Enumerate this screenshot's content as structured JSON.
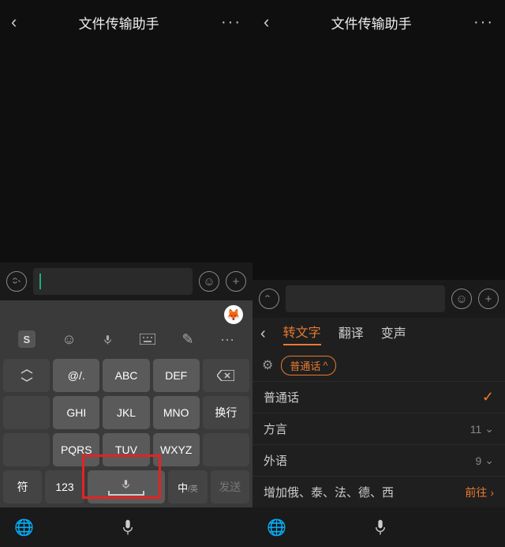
{
  "left": {
    "header": {
      "title": "文件传输助手"
    },
    "keyboard": {
      "row1": [
        {
          "label": "",
          "dark": true,
          "name": "kb-key-toggle"
        },
        {
          "label": "@/.",
          "name": "kb-key-at"
        },
        {
          "label": "ABC",
          "name": "kb-key-abc"
        },
        {
          "label": "DEF",
          "name": "kb-key-def"
        },
        {
          "label": "",
          "dark": true,
          "name": "kb-key-backspace"
        }
      ],
      "row2": [
        {
          "label": "",
          "dark": true,
          "name": "kb-key-back"
        },
        {
          "label": "GHI",
          "name": "kb-key-ghi"
        },
        {
          "label": "JKL",
          "name": "kb-key-jkl"
        },
        {
          "label": "MNO",
          "name": "kb-key-mno"
        },
        {
          "label": "换行",
          "dark": true,
          "name": "kb-key-newline"
        }
      ],
      "row3": [
        {
          "label": "",
          "dark": true,
          "name": "kb-key-blank"
        },
        {
          "label": "PQRS",
          "name": "kb-key-pqrs"
        },
        {
          "label": "TUV",
          "name": "kb-key-tuv"
        },
        {
          "label": "WXYZ",
          "name": "kb-key-wxyz"
        },
        {
          "label": "",
          "dark": true,
          "name": "kb-key-blank2"
        }
      ],
      "row4": [
        {
          "label": "符",
          "dark": true,
          "name": "kb-key-symbols"
        },
        {
          "label": "123",
          "dark": true,
          "name": "kb-key-numbers"
        },
        {
          "label": "",
          "space": true,
          "name": "kb-key-space-voice"
        },
        {
          "label": "中/英",
          "dark": true,
          "name": "kb-key-lang"
        },
        {
          "label": "发送",
          "dark": true,
          "name": "kb-key-send"
        }
      ]
    }
  },
  "right": {
    "header": {
      "title": "文件传输助手"
    },
    "tabs": [
      {
        "label": "转文字",
        "active": true
      },
      {
        "label": "翻译",
        "active": false
      },
      {
        "label": "变声",
        "active": false
      }
    ],
    "pill": "普通话",
    "langRows": [
      {
        "label": "普通话",
        "checked": true
      },
      {
        "label": "方言",
        "count": "11"
      },
      {
        "label": "外语",
        "count": "9"
      },
      {
        "label": "增加俄、泰、法、德、西",
        "goto": "前往"
      }
    ]
  }
}
